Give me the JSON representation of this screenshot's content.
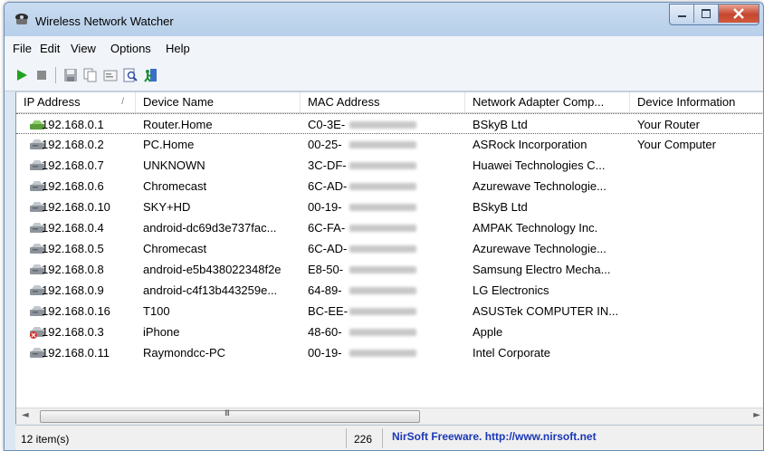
{
  "window": {
    "title": "Wireless Network Watcher"
  },
  "menu": [
    "File",
    "Edit",
    "View",
    "Options",
    "Help"
  ],
  "toolbar": {
    "icons": [
      "play-icon",
      "stop-icon",
      "save-icon",
      "copy-icon",
      "properties-icon",
      "find-icon",
      "exit-icon"
    ]
  },
  "columns": [
    "IP Address",
    "Device Name",
    "MAC Address",
    "Network Adapter Comp...",
    "Device Information"
  ],
  "sort_indicator": "/",
  "rows": [
    {
      "ip": "192.168.0.1",
      "name": "Router.Home",
      "mac": "C0-3E-",
      "vendor": "BSkyB Ltd",
      "info": "Your Router",
      "icon": "router-icon"
    },
    {
      "ip": "192.168.0.2",
      "name": "PC.Home",
      "mac": "00-25-",
      "vendor": "ASRock Incorporation",
      "info": "Your Computer",
      "icon": "device-icon"
    },
    {
      "ip": "192.168.0.7",
      "name": "UNKNOWN",
      "mac": "3C-DF-",
      "vendor": "Huawei Technologies C...",
      "info": "",
      "icon": "device-icon"
    },
    {
      "ip": "192.168.0.6",
      "name": "Chromecast",
      "mac": "6C-AD-",
      "vendor": "Azurewave Technologie...",
      "info": "",
      "icon": "device-icon"
    },
    {
      "ip": "192.168.0.10",
      "name": "SKY+HD",
      "mac": "00-19-",
      "vendor": "BSkyB Ltd",
      "info": "",
      "icon": "device-icon"
    },
    {
      "ip": "192.168.0.4",
      "name": "android-dc69d3e737fac...",
      "mac": "6C-FA-",
      "vendor": "AMPAK Technology Inc.",
      "info": "",
      "icon": "device-icon"
    },
    {
      "ip": "192.168.0.5",
      "name": "Chromecast",
      "mac": "6C-AD-",
      "vendor": "Azurewave Technologie...",
      "info": "",
      "icon": "device-icon"
    },
    {
      "ip": "192.168.0.8",
      "name": "android-e5b438022348f2e",
      "mac": "E8-50-",
      "vendor": "Samsung Electro Mecha...",
      "info": "",
      "icon": "device-icon"
    },
    {
      "ip": "192.168.0.9",
      "name": "android-c4f13b443259e...",
      "mac": "64-89-",
      "vendor": "LG Electronics",
      "info": "",
      "icon": "device-icon"
    },
    {
      "ip": "192.168.0.16",
      "name": "T100",
      "mac": "BC-EE-",
      "vendor": "ASUSTek COMPUTER IN...",
      "info": "",
      "icon": "device-icon"
    },
    {
      "ip": "192.168.0.3",
      "name": "iPhone",
      "mac": "48-60-",
      "vendor": "Apple",
      "info": "",
      "icon": "device-offline-icon"
    },
    {
      "ip": "192.168.0.11",
      "name": "Raymondcc-PC",
      "mac": "00-19-",
      "vendor": "Intel Corporate",
      "info": "",
      "icon": "device-icon"
    }
  ],
  "scrollbar": {
    "left": "◄",
    "grip": "III",
    "right": "►"
  },
  "status": {
    "items": "12 item(s)",
    "count": "226",
    "link": "NirSoft Freeware.  http://www.nirsoft.net"
  },
  "colors": {
    "link": "#1a37b8",
    "play": "#1fa31f",
    "close": "#c6462e",
    "masked": "#c8c8c8"
  }
}
